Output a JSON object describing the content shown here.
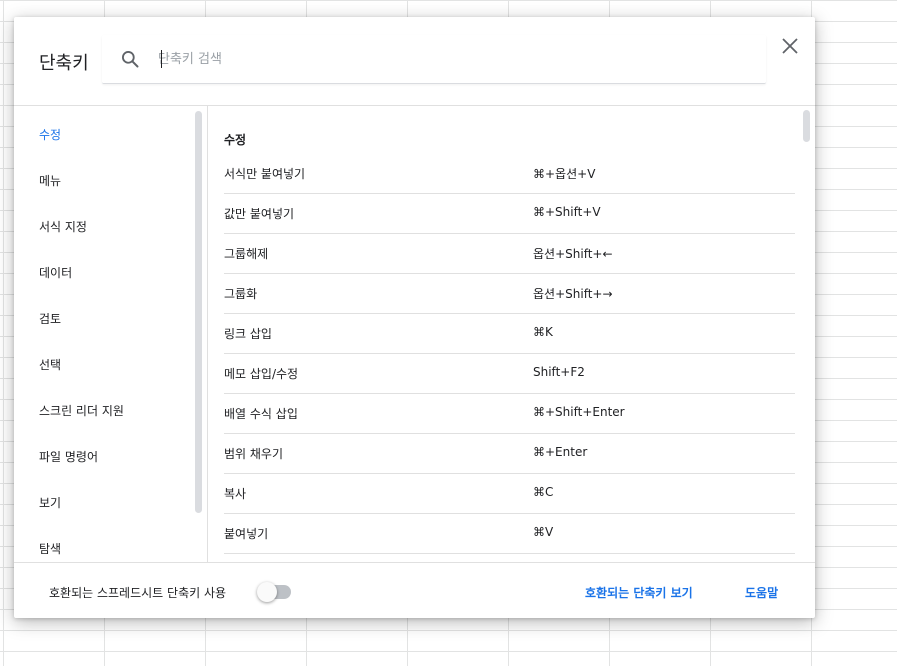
{
  "dialog": {
    "title": "단축키",
    "search": {
      "placeholder": "단축키 검색",
      "value": ""
    }
  },
  "sidebar": {
    "items": [
      {
        "label": "수정",
        "active": true
      },
      {
        "label": "메뉴"
      },
      {
        "label": "서식 지정"
      },
      {
        "label": "데이터"
      },
      {
        "label": "검토"
      },
      {
        "label": "선택"
      },
      {
        "label": "스크린 리더 지원"
      },
      {
        "label": "파일 명령어"
      },
      {
        "label": "보기"
      },
      {
        "label": "탐색"
      }
    ]
  },
  "content": {
    "section_title": "수정",
    "shortcuts": [
      {
        "name": "서식만 붙여넣기",
        "keys": "⌘+옵션+V"
      },
      {
        "name": "값만 붙여넣기",
        "keys": "⌘+Shift+V"
      },
      {
        "name": "그룹해제",
        "keys": "옵션+Shift+←"
      },
      {
        "name": "그룹화",
        "keys": "옵션+Shift+→"
      },
      {
        "name": "링크 삽입",
        "keys": "⌘K"
      },
      {
        "name": "메모 삽입/수정",
        "keys": "Shift+F2"
      },
      {
        "name": "배열 수식 삽입",
        "keys": "⌘+Shift+Enter"
      },
      {
        "name": "범위 채우기",
        "keys": "⌘+Enter"
      },
      {
        "name": "복사",
        "keys": "⌘C"
      },
      {
        "name": "붙여넣기",
        "keys": "⌘V"
      }
    ]
  },
  "footer": {
    "compat_label": "호환되는 스프레드시트 단축키 사용",
    "compat_enabled": false,
    "view_compat_link": "호환되는 단축키 보기",
    "help_link": "도움말"
  },
  "icons": {
    "search": "search-icon",
    "close": "close-icon"
  },
  "colors": {
    "accent": "#1a73e8",
    "text": "#202124",
    "divider": "#e0e0e0"
  }
}
